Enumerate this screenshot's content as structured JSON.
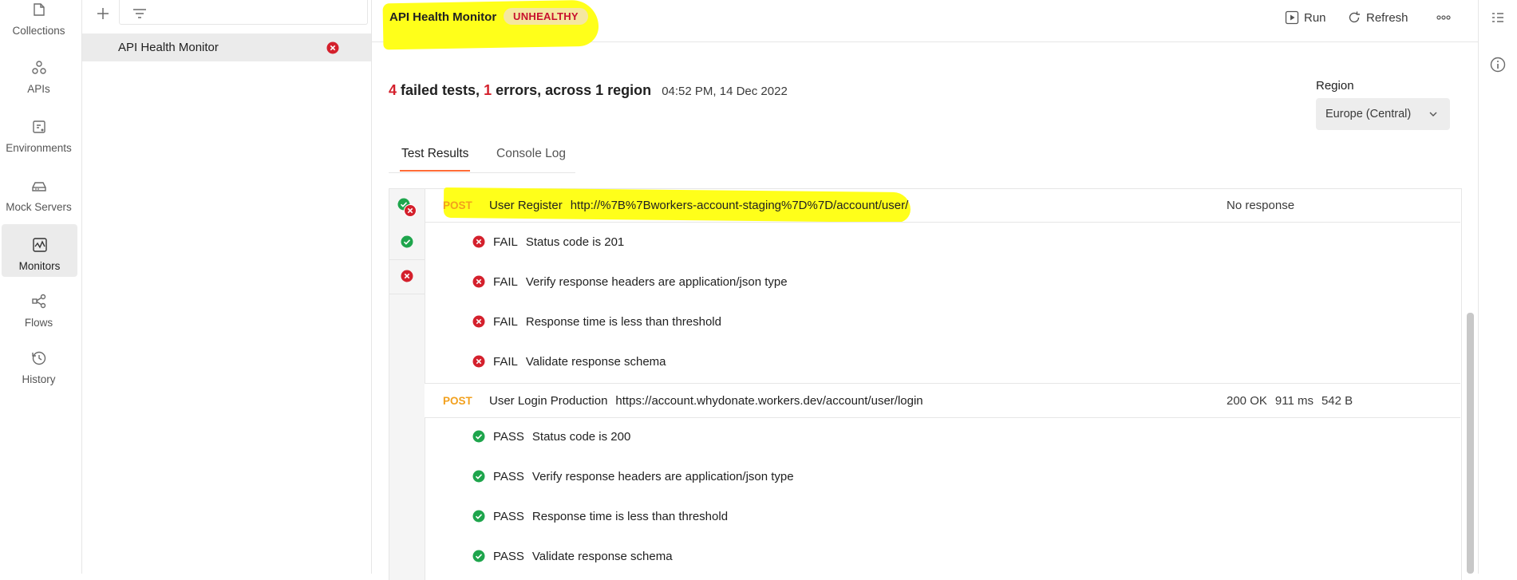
{
  "nav": {
    "items": [
      {
        "label": "Collections",
        "icon": "collections-icon"
      },
      {
        "label": "APIs",
        "icon": "apis-icon"
      },
      {
        "label": "Environments",
        "icon": "environments-icon"
      },
      {
        "label": "Mock Servers",
        "icon": "mock-servers-icon"
      },
      {
        "label": "Monitors",
        "icon": "monitors-icon",
        "active": true
      },
      {
        "label": "Flows",
        "icon": "flows-icon"
      },
      {
        "label": "History",
        "icon": "history-icon"
      }
    ]
  },
  "sidebar": {
    "monitor": {
      "name": "API Health Monitor",
      "status": "failed"
    }
  },
  "header": {
    "title": "API Health Monitor",
    "badge": "UNHEALTHY",
    "run_label": "Run",
    "refresh_label": "Refresh"
  },
  "summary": {
    "failed_count": "4",
    "failed_text": " failed tests, ",
    "error_count": "1",
    "error_text": " errors, across 1 region",
    "timestamp": "04:52 PM, 14 Dec 2022"
  },
  "region": {
    "label": "Region",
    "selected": "Europe (Central)"
  },
  "tabs": {
    "results": "Test Results",
    "console": "Console Log"
  },
  "requests": [
    {
      "method": "POST",
      "name": "User Register",
      "url": "http://%7B%7Bworkers-account-staging%7D%7D/account/user/",
      "response": "No response",
      "tests": [
        {
          "status": "FAIL",
          "name": "Status code is 201"
        },
        {
          "status": "FAIL",
          "name": "Verify response headers are application/json type"
        },
        {
          "status": "FAIL",
          "name": "Response time is less than threshold"
        },
        {
          "status": "FAIL",
          "name": "Validate response schema"
        }
      ]
    },
    {
      "method": "POST",
      "name": "User Login Production",
      "url": "https://account.whydonate.workers.dev/account/user/login",
      "response_code": "200 OK",
      "response_time": "911 ms",
      "response_size": "542 B",
      "tests": [
        {
          "status": "PASS",
          "name": "Status code is 200"
        },
        {
          "status": "PASS",
          "name": "Verify response headers are application/json type"
        },
        {
          "status": "PASS",
          "name": "Response time is less than threshold"
        },
        {
          "status": "PASS",
          "name": "Validate response schema"
        }
      ]
    }
  ],
  "colors": {
    "fail": "#d4202c",
    "pass": "#1ea54c",
    "method": "#f2a01d",
    "accent": "#ff6c37",
    "highlight": "#ffff1a"
  }
}
